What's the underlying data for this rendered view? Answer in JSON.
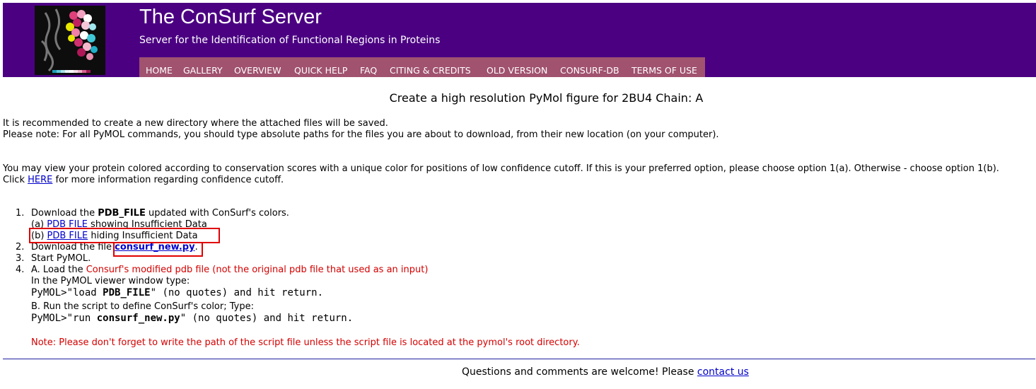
{
  "header": {
    "title": "The ConSurf Server",
    "subtitle": "Server for the Identification of Functional Regions in Proteins",
    "nav": [
      "HOME",
      "GALLERY",
      "OVERVIEW",
      "QUICK HELP",
      "FAQ",
      "CITING & CREDITS",
      "OLD VERSION",
      "CONSURF-DB",
      "TERMS OF USE"
    ]
  },
  "colors": {
    "header_bg": "#4b0082",
    "nav_bg": "#a0526e",
    "highlight": "#e00000",
    "link": "#0000cc",
    "note": "#d40000"
  },
  "main": {
    "title": "Create a high resolution PyMol figure for 2BU4 Chain: A",
    "intro1": "It is recommended to create a new directory where the attached files will be saved.",
    "intro2": "Please note: For all PyMOL commands, you should type absolute paths for the files you are about to download, from their new location (on your computer).",
    "cutoff1": "You may view your protein colored according to conservation scores with a unique color for positions of low confidence cutoff. If this is your preferred option, please choose option 1(a). Otherwise - choose option 1(b).",
    "cutoff2_pre": "Click ",
    "cutoff2_link": "HERE",
    "cutoff2_post": " for more information regarding confidence cutoff.",
    "steps": {
      "n1": "1.",
      "s1_pre": "Download the ",
      "s1_bold": "PDB_FILE",
      "s1_post": " updated with ConSurf's colors.",
      "a_pre": "(a) ",
      "a_link": "PDB FILE",
      "a_post": " showing Insufficient Data",
      "b_pre": "(b) ",
      "b_link": "PDB FILE",
      "b_post": " hiding Insufficient Data",
      "n2": "2.",
      "s2_pre": "Download the file ",
      "s2_link": "consurf_new.py",
      "s2_post": ".",
      "n3": "3.",
      "s3": "Start PyMOL.",
      "n4": "4.",
      "s4_pre": "A. Load the ",
      "s4_red": "Consurf's modified pdb file (not the original pdb file that used as an input)",
      "s4_line2": "In the PyMOL viewer window type:",
      "cmd1_a": "PyMOL>\"load ",
      "cmd1_b": "PDB_FILE",
      "cmd1_c": "\" (no quotes) and hit return.",
      "s4_line4": "B. Run the script to define ConSurf's color; Type:",
      "cmd2_a": "PyMOL>\"run ",
      "cmd2_b": "consurf_new.py",
      "cmd2_c": "\" (no quotes) and hit return.",
      "note": "Note: Please don't forget to write the path of the script file unless the script file is located at the pymol's root directory."
    }
  },
  "footer": {
    "text": "Questions and comments are welcome! Please ",
    "link": "contact us"
  }
}
